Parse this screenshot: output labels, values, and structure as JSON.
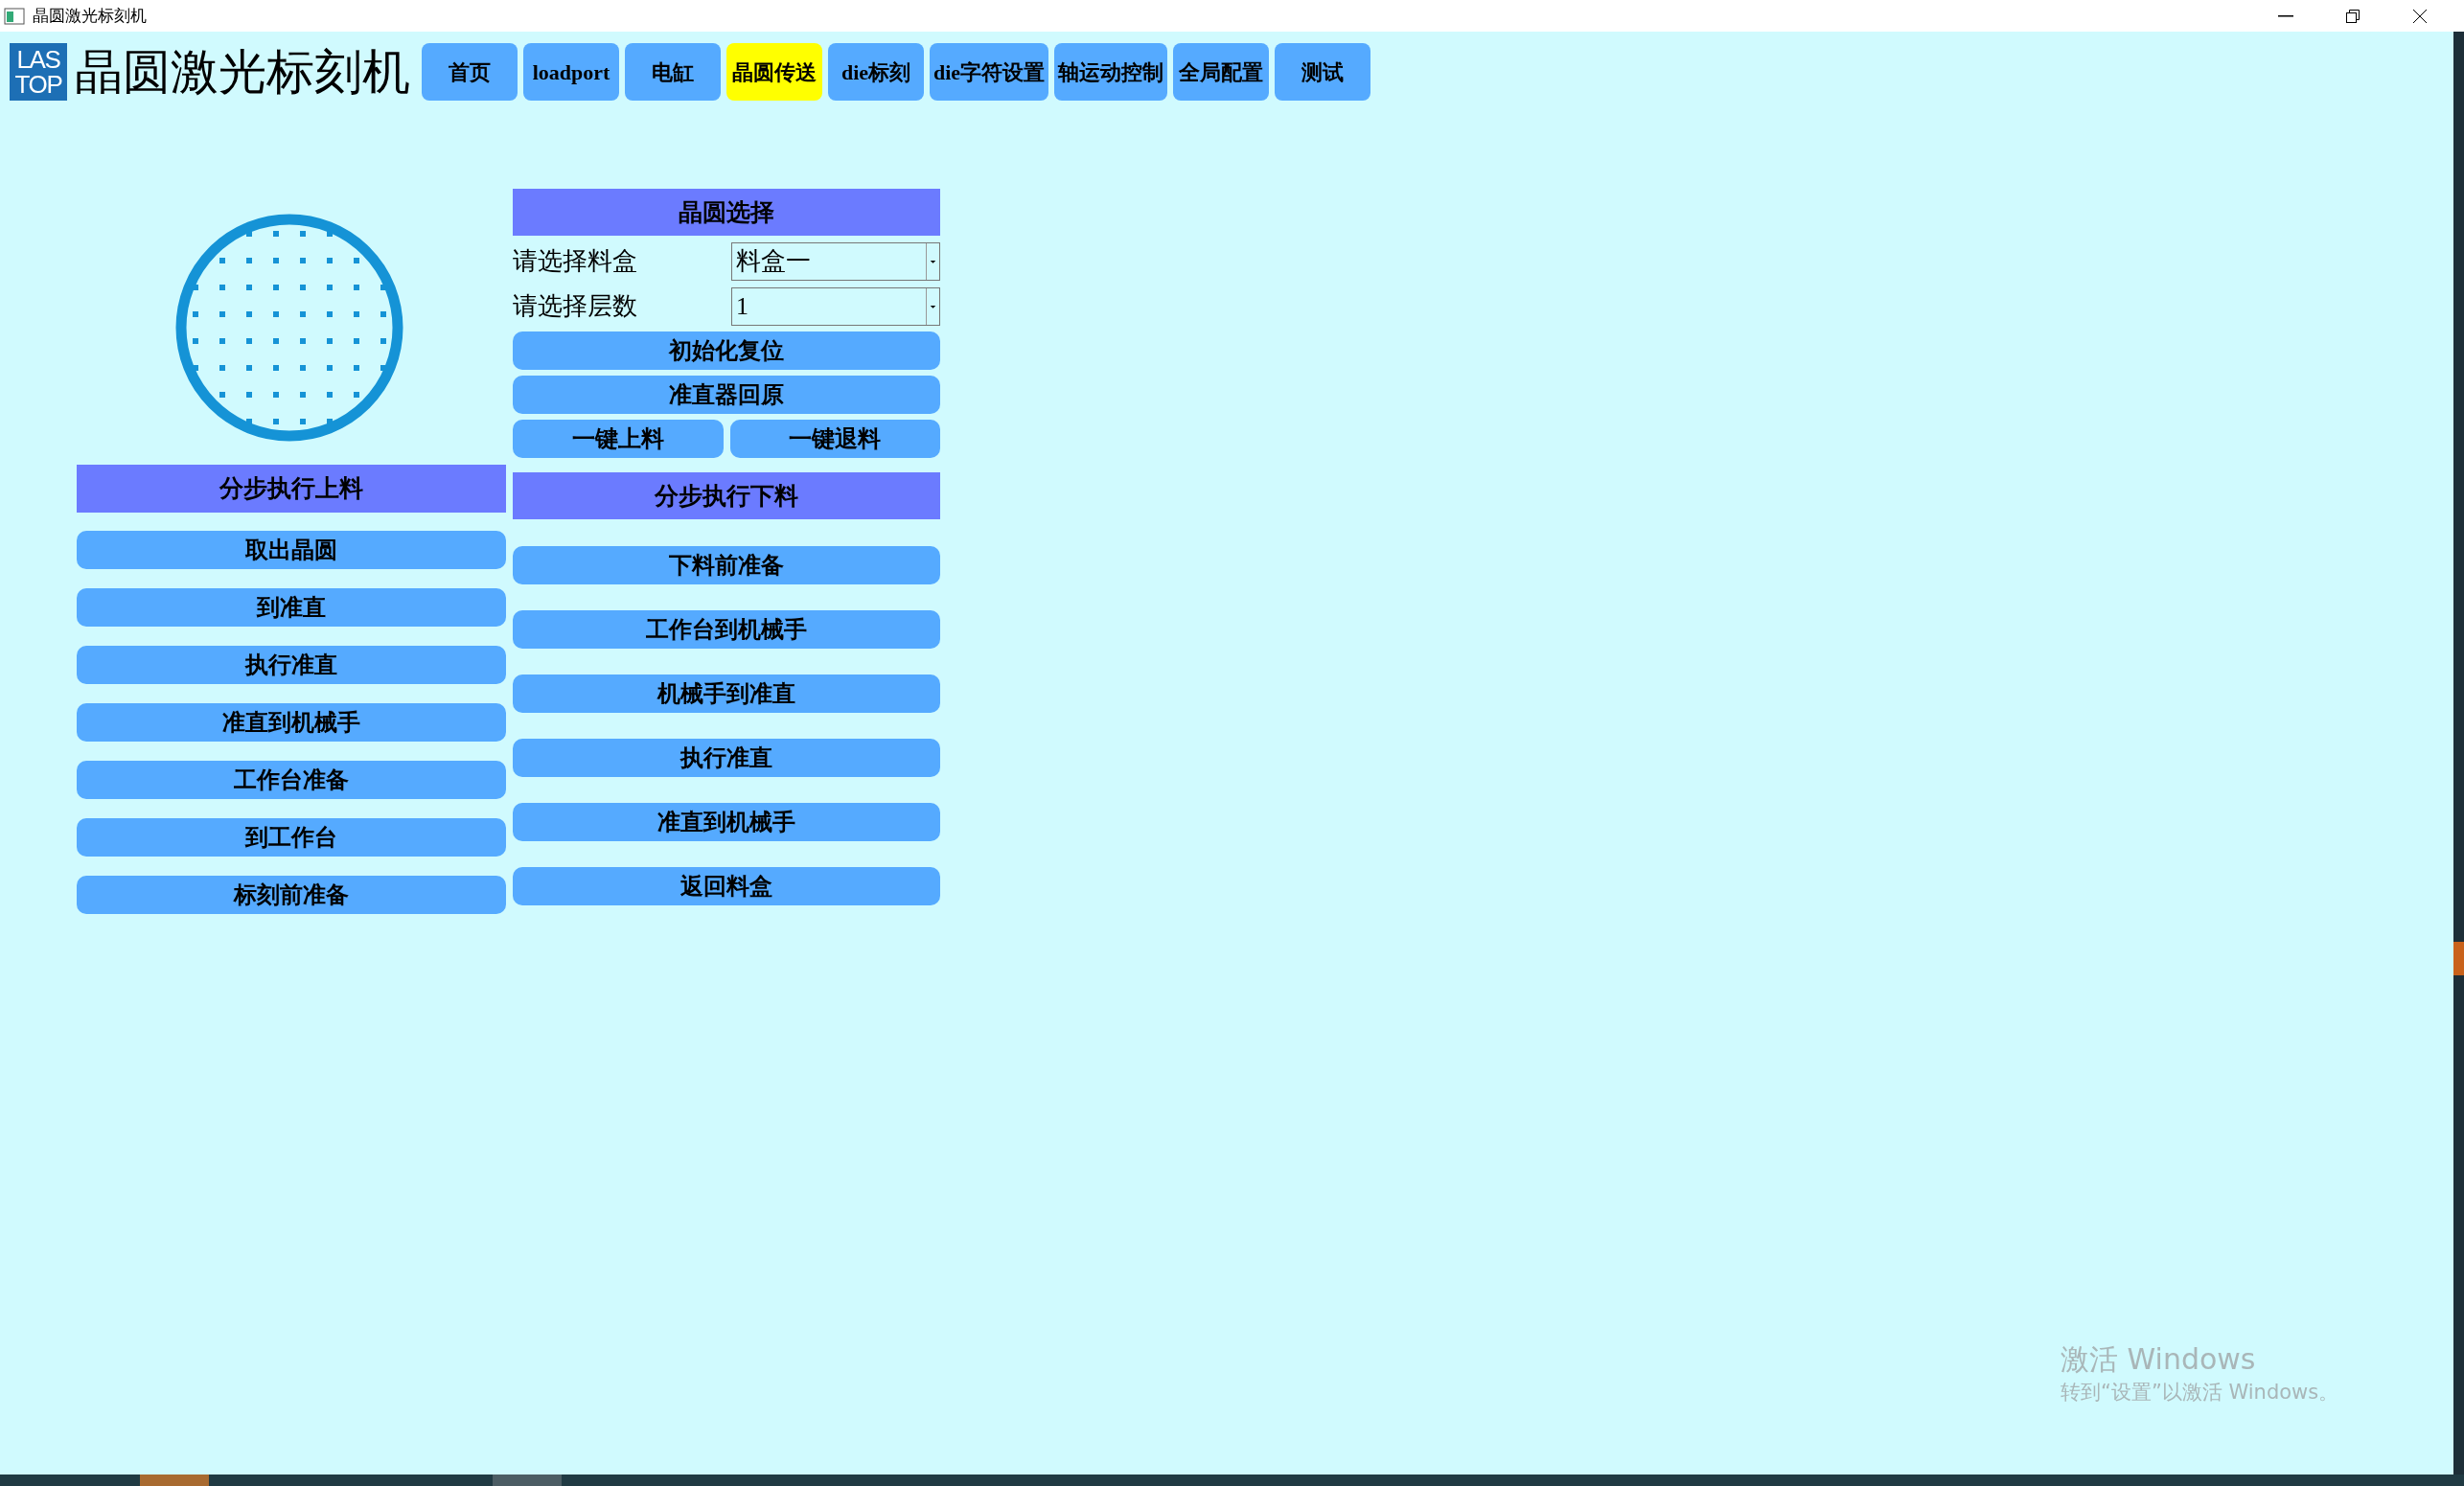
{
  "window": {
    "title": "晶圆激光标刻机"
  },
  "header": {
    "logo": {
      "line1": "LAS",
      "line2": "TOP"
    },
    "title": "晶圆激光标刻机"
  },
  "nav": [
    {
      "label": "首页",
      "selected": false
    },
    {
      "label": "loadport",
      "selected": false
    },
    {
      "label": "电缸",
      "selected": false
    },
    {
      "label": "晶圆传送",
      "selected": true
    },
    {
      "label": "die标刻",
      "selected": false
    },
    {
      "label": "die字符设置",
      "selected": false
    },
    {
      "label": "轴运动控制",
      "selected": false
    },
    {
      "label": "全局配置",
      "selected": false
    },
    {
      "label": "测试",
      "selected": false
    }
  ],
  "wafer_selection": {
    "title": "晶圆选择",
    "fields": [
      {
        "label": "请选择料盒",
        "value": "料盒一"
      },
      {
        "label": "请选择层数",
        "value": "1"
      }
    ],
    "buttons": [
      "初始化复位",
      "准直器回原"
    ],
    "pair_buttons": [
      "一键上料",
      "一键退料"
    ]
  },
  "load_steps": {
    "title": "分步执行上料",
    "buttons": [
      "取出晶圆",
      "到准直",
      "执行准直",
      "准直到机械手",
      "工作台准备",
      "到工作台",
      "标刻前准备"
    ]
  },
  "unload_steps": {
    "title": "分步执行下料",
    "buttons": [
      "下料前准备",
      "工作台到机械手",
      "机械手到准直",
      "执行准直",
      "准直到机械手",
      "返回料盒"
    ]
  },
  "activation_notice": {
    "title": "激活 Windows",
    "subtitle": "转到“设置”以激活 Windows。"
  }
}
